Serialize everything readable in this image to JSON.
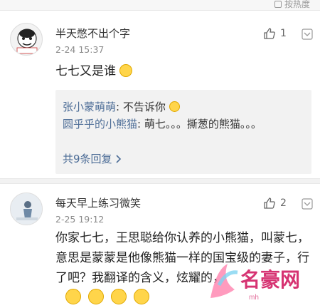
{
  "topbar": {
    "hot_label": "按热度"
  },
  "comments": [
    {
      "user": "半天憋不出个字",
      "time": "2-24 15:37",
      "likes": "1",
      "text": "七七又是谁",
      "replies": [
        {
          "user": "张小蒙萌萌",
          "text": ": 不告诉你"
        },
        {
          "user": "圆乎乎的小熊猫",
          "text": ": 萌七。。。撕葱的熊猫。。。"
        }
      ],
      "reply_count": "共9条回复"
    },
    {
      "user": "每天早上练习微笑",
      "time": "2-25 19:12",
      "likes": "2",
      "text": "你家七七，王思聪给你认养的小熊猫，叫蒙七，意思是蒙蒙是他像熊猫一样的国宝级的妻子，行了吧？我翻译的含义，炫耀的，"
    }
  ]
}
